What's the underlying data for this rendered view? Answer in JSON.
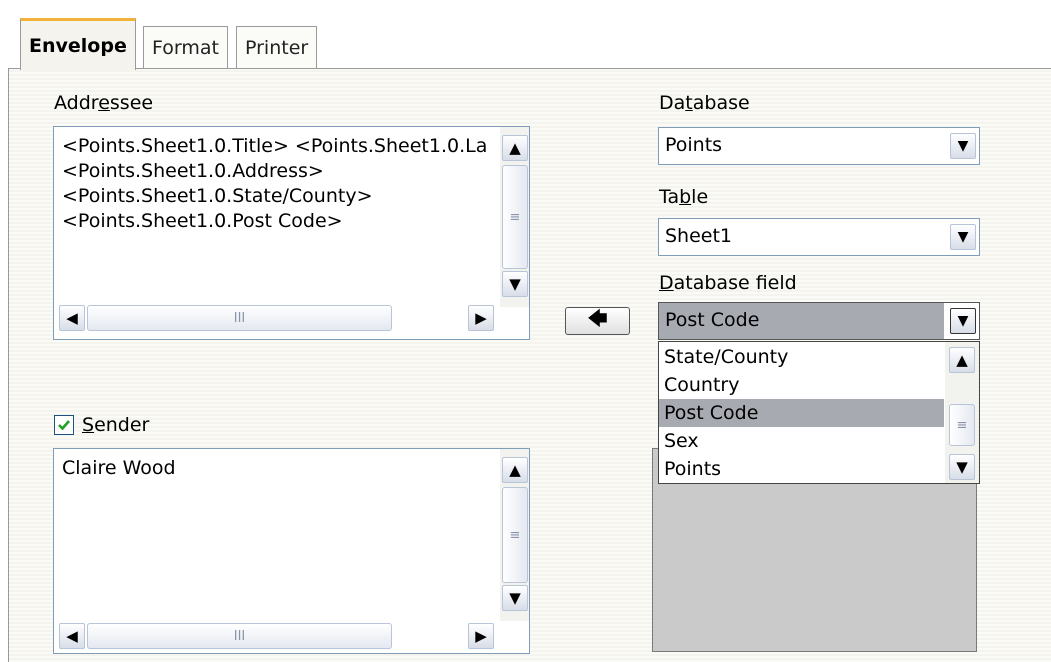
{
  "tabs": [
    {
      "label": "Envelope",
      "active": true
    },
    {
      "label": "Format",
      "active": false
    },
    {
      "label": "Printer",
      "active": false
    }
  ],
  "addressee": {
    "label_pre": "Addr",
    "label_u": "e",
    "label_post": "ssee",
    "lines": [
      "<Points.Sheet1.0.Title> <Points.Sheet1.0.La",
      "<Points.Sheet1.0.Address>",
      "<Points.Sheet1.0.State/County>",
      "<Points.Sheet1.0.Post Code>"
    ]
  },
  "insert_button": {
    "icon": "arrow-left-icon",
    "glyph": "🡄"
  },
  "database": {
    "label_pre": "Da",
    "label_u": "t",
    "label_post": "abase",
    "value": "Points"
  },
  "table": {
    "label_pre": "Ta",
    "label_u": "b",
    "label_post": "le",
    "value": "Sheet1"
  },
  "database_field": {
    "label_u": "D",
    "label_post": "atabase field",
    "value": "Post Code",
    "options": [
      "State/County",
      "Country",
      "Post Code",
      "Sex",
      "Points"
    ],
    "selected": "Post Code"
  },
  "sender": {
    "checked": true,
    "label_u": "S",
    "label_post": "ender",
    "lines": [
      "Claire Wood"
    ]
  },
  "scroll": {
    "up": "▲",
    "down": "▼",
    "left": "◀",
    "right": "▶",
    "grip": "≡",
    "hgrip": "III"
  },
  "colors": {
    "tab_accent": "#f2b23a",
    "selection": "#a8aab2",
    "border": "#7f9db9"
  }
}
